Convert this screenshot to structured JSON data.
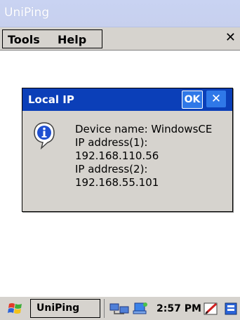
{
  "window": {
    "title": "UniPing"
  },
  "menubar": {
    "tools_label": "Tools",
    "help_label": "Help",
    "close_glyph": "✕"
  },
  "dialog": {
    "title": "Local IP",
    "ok_label": "OK",
    "close_glyph": "✕",
    "icon": "info-icon",
    "lines": [
      "Device name: WindowsCE",
      "IP address(1):",
      "192.168.110.56",
      "IP address(2):",
      "192.168.55.101"
    ]
  },
  "taskbar": {
    "start_icon": "windows-flag-icon",
    "app_label": "UniPing",
    "clock": "2:57 PM",
    "tray_icons": [
      "network-icon",
      "connection-icon",
      "pen-icon",
      "keyboard-icon"
    ]
  },
  "colors": {
    "title_inactive": "#c9d3f2",
    "dialog_title": "#0b3fb8",
    "button_blue": "#2f78e8",
    "chrome_gray": "#d6d3ce"
  }
}
